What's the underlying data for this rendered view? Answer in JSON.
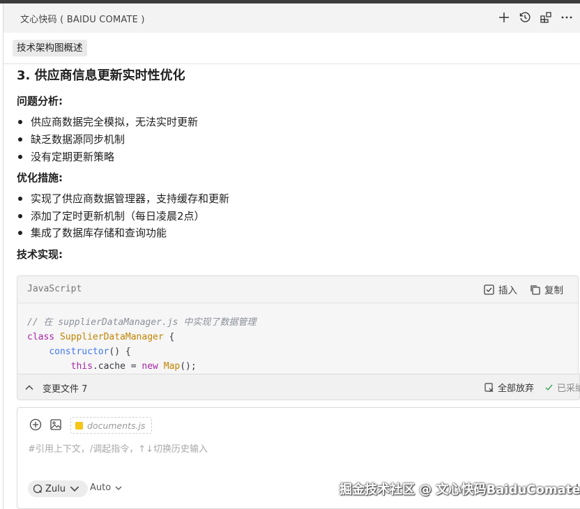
{
  "header": {
    "title": "文心快码 ( BAIDU COMATE )",
    "icons": [
      "plus-icon",
      "history-icon",
      "extensions-icon",
      "more-icon"
    ]
  },
  "context_chip": "技术架构图概述",
  "section": {
    "title": "3. 供应商信息更新实时性优化",
    "problem_heading": "问题分析:",
    "problems": [
      "供应商数据完全模拟，无法实时更新",
      "缺乏数据源同步机制",
      "没有定期更新策略"
    ],
    "measures_heading": "优化措施:",
    "measures": [
      "实现了供应商数据管理器，支持缓存和更新",
      "添加了定时更新机制（每日凌晨2点）",
      "集成了数据库存储和查询功能"
    ],
    "impl_heading": "技术实现:"
  },
  "code": {
    "language": "JavaScript",
    "insert_label": "插入",
    "copy_label": "复制",
    "line1_comment": "// 在 supplierDataManager.js 中实现了数据管理",
    "line2_kw": "class",
    "line2_cls": "SupplierDataManager",
    "line2_rest": " {",
    "line3_fn": "constructor",
    "line3_rest": "() {",
    "line4_kw": "this",
    "line4_mid": ".cache = ",
    "line4_new": "new",
    "line4_cls": "Map",
    "line4_rest": "();"
  },
  "changes": {
    "label": "变更文件 7",
    "discard_label": "全部放弃",
    "accept_label": "已采纳"
  },
  "input": {
    "file_chip": "documents.js",
    "placeholder": "#引用上下文，/调起指令，↑↓切换历史输入",
    "model": "Zulu",
    "mode": "Auto"
  },
  "watermark": "掘金技术社区 @ 文心快码BaiduComate",
  "colors": {
    "accent_yellow": "#f5c518",
    "accept_green": "#3aa657",
    "header_bg": "#f3f3f3"
  }
}
